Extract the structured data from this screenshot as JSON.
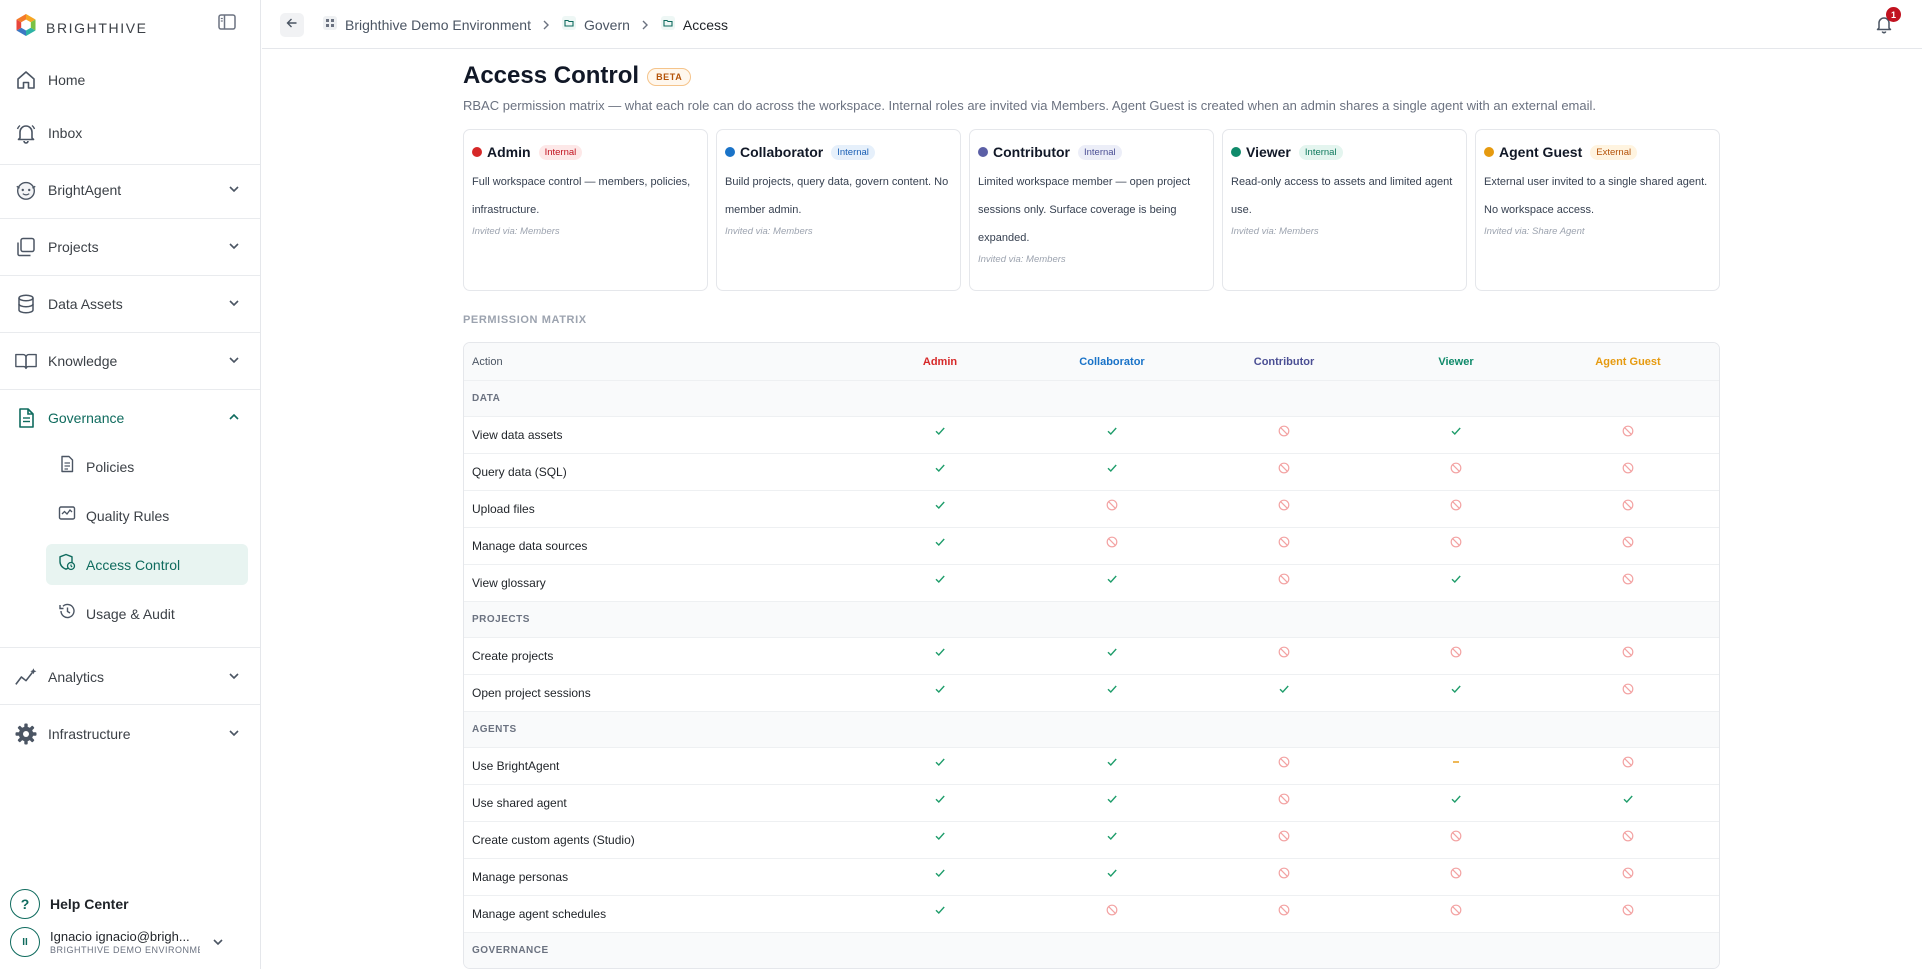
{
  "brand": {
    "name": "BRIGHTHIVE"
  },
  "sidebar": {
    "items": [
      {
        "label": "Home"
      },
      {
        "label": "Inbox"
      },
      {
        "label": "BrightAgent"
      },
      {
        "label": "Projects"
      },
      {
        "label": "Data Assets"
      },
      {
        "label": "Knowledge"
      },
      {
        "label": "Governance"
      },
      {
        "label": "Analytics"
      },
      {
        "label": "Infrastructure"
      }
    ],
    "governance_sub": [
      {
        "label": "Policies"
      },
      {
        "label": "Quality Rules"
      },
      {
        "label": "Access Control"
      },
      {
        "label": "Usage & Audit"
      }
    ],
    "help_label": "Help Center",
    "user": {
      "initials": "II",
      "name": "Ignacio ignacio@brigh...",
      "env": "BRIGHTHIVE DEMO ENVIRONMENT"
    }
  },
  "topbar": {
    "breadcrumb": [
      "Brighthive Demo Environment",
      "Govern",
      "Access"
    ],
    "notification_count": "1"
  },
  "page": {
    "title": "Access Control",
    "badge": "BETA",
    "subtitle": "RBAC permission matrix — what each role can do across the workspace. Internal roles are invited via Members. Agent Guest is created when an admin shares a single agent with an external email."
  },
  "roles": [
    {
      "name": "Admin",
      "tag": "Internal",
      "color": "#d62828",
      "tag_color": "#c1121f",
      "tag_bg": "#fde8e8",
      "desc": "Full workspace control — members, policies, infrastructure.",
      "via": "Invited via: Members"
    },
    {
      "name": "Collaborator",
      "tag": "Internal",
      "color": "#1a73c8",
      "tag_color": "#1a5fb4",
      "tag_bg": "#e6f0fb",
      "desc": "Build projects, query data, govern content. No member admin.",
      "via": "Invited via: Members"
    },
    {
      "name": "Contributor",
      "tag": "Internal",
      "color": "#5b5fa6",
      "tag_color": "#4b4f94",
      "tag_bg": "#eceef8",
      "desc": "Limited workspace member — open project sessions only. Surface coverage is being expanded.",
      "via": "Invited via: Members"
    },
    {
      "name": "Viewer",
      "tag": "Internal",
      "color": "#0f8a6a",
      "tag_color": "#0f7a5e",
      "tag_bg": "#e4f5ef",
      "desc": "Read-only access to assets and limited agent use.",
      "via": "Invited via: Members"
    },
    {
      "name": "Agent Guest",
      "tag": "External",
      "color": "#e69a0f",
      "tag_color": "#b45309",
      "tag_bg": "#fff4e0",
      "desc": "External user invited to a single shared agent. No workspace access.",
      "via": "Invited via: Share Agent"
    }
  ],
  "matrix": {
    "section_label": "PERMISSION MATRIX",
    "action_header": "Action",
    "header_colors": [
      "#d62828",
      "#1a73c8",
      "#4b4f94",
      "#0f8a6a",
      "#e69a0f"
    ],
    "rows": [
      {
        "type": "group",
        "label": "DATA"
      },
      {
        "type": "perm",
        "label": "View data assets",
        "perms": [
          "yes",
          "yes",
          "no",
          "yes",
          "no"
        ]
      },
      {
        "type": "perm",
        "label": "Query data (SQL)",
        "perms": [
          "yes",
          "yes",
          "no",
          "no",
          "no"
        ]
      },
      {
        "type": "perm",
        "label": "Upload files",
        "perms": [
          "yes",
          "no",
          "no",
          "no",
          "no"
        ]
      },
      {
        "type": "perm",
        "label": "Manage data sources",
        "perms": [
          "yes",
          "no",
          "no",
          "no",
          "no"
        ]
      },
      {
        "type": "perm",
        "label": "View glossary",
        "perms": [
          "yes",
          "yes",
          "no",
          "yes",
          "no"
        ]
      },
      {
        "type": "group",
        "label": "PROJECTS"
      },
      {
        "type": "perm",
        "label": "Create projects",
        "perms": [
          "yes",
          "yes",
          "no",
          "no",
          "no"
        ]
      },
      {
        "type": "perm",
        "label": "Open project sessions",
        "perms": [
          "yes",
          "yes",
          "yes",
          "yes",
          "no"
        ]
      },
      {
        "type": "group",
        "label": "AGENTS"
      },
      {
        "type": "perm",
        "label": "Use BrightAgent",
        "perms": [
          "yes",
          "yes",
          "no",
          "partial",
          "no"
        ]
      },
      {
        "type": "perm",
        "label": "Use shared agent",
        "perms": [
          "yes",
          "yes",
          "no",
          "yes",
          "yes"
        ]
      },
      {
        "type": "perm",
        "label": "Create custom agents (Studio)",
        "perms": [
          "yes",
          "yes",
          "no",
          "no",
          "no"
        ]
      },
      {
        "type": "perm",
        "label": "Manage personas",
        "perms": [
          "yes",
          "yes",
          "no",
          "no",
          "no"
        ]
      },
      {
        "type": "perm",
        "label": "Manage agent schedules",
        "perms": [
          "yes",
          "no",
          "no",
          "no",
          "no"
        ]
      },
      {
        "type": "group",
        "label": "GOVERNANCE"
      }
    ]
  },
  "colors": {
    "accent": "#0f6b5e",
    "yes": "#1f9d6b",
    "no": "#f3a3a3",
    "partial": "#e69a0f"
  }
}
